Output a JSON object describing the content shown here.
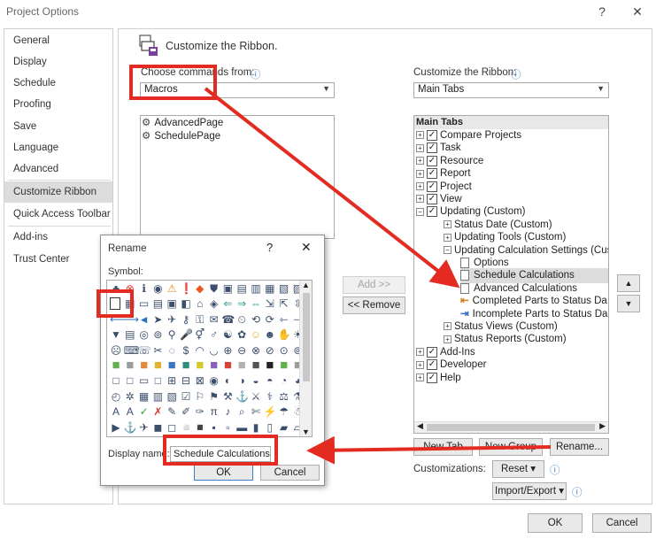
{
  "window": {
    "title": "Project Options",
    "help_btn": "?",
    "close_btn": "✕"
  },
  "nav": {
    "items": [
      {
        "label": "General"
      },
      {
        "label": "Display"
      },
      {
        "label": "Schedule"
      },
      {
        "label": "Proofing"
      },
      {
        "label": "Save"
      },
      {
        "label": "Language"
      },
      {
        "label": "Advanced"
      },
      {
        "label": "Customize Ribbon",
        "active": true
      },
      {
        "label": "Quick Access Toolbar"
      },
      {
        "label": "Add-ins"
      },
      {
        "label": "Trust Center"
      }
    ]
  },
  "main": {
    "heading": "Customize the Ribbon.",
    "choose_label": "Choose commands from:",
    "choose_value": "Macros",
    "ribbon_label": "Customize the Ribbon:",
    "ribbon_value": "Main Tabs",
    "info_icon": "ⓘ",
    "commands": [
      {
        "label": "AdvancedPage"
      },
      {
        "label": "SchedulePage"
      }
    ],
    "add_btn": "Add >>",
    "remove_btn": "<< Remove",
    "tree_header": "Main Tabs",
    "tree": [
      {
        "label": "Compare Projects",
        "level": 0,
        "exp": "+",
        "chk": true
      },
      {
        "label": "Task",
        "level": 0,
        "exp": "+",
        "chk": true
      },
      {
        "label": "Resource",
        "level": 0,
        "exp": "+",
        "chk": true
      },
      {
        "label": "Report",
        "level": 0,
        "exp": "+",
        "chk": true
      },
      {
        "label": "Project",
        "level": 0,
        "exp": "+",
        "chk": true
      },
      {
        "label": "View",
        "level": 0,
        "exp": "+",
        "chk": true
      },
      {
        "label": "Updating (Custom)",
        "level": 0,
        "exp": "−",
        "chk": true
      },
      {
        "label": "Status Date (Custom)",
        "level": 1,
        "exp": "+"
      },
      {
        "label": "Updating Tools (Custom)",
        "level": 1,
        "exp": "+"
      },
      {
        "label": "Updating Calculation Settings (Custo",
        "level": 1,
        "exp": "−"
      },
      {
        "label": "Options",
        "level": 2,
        "icon": "page"
      },
      {
        "label": "Schedule Calculations",
        "level": 2,
        "icon": "page",
        "selected": true
      },
      {
        "label": "Advanced Calculations",
        "level": 2,
        "icon": "page"
      },
      {
        "label": "Completed Parts to Status Da",
        "level": 2,
        "icon": "arrow-left"
      },
      {
        "label": "Incomplete Parts to Status Da",
        "level": 2,
        "icon": "arrow-right"
      },
      {
        "label": "Status Views (Custom)",
        "level": 1,
        "exp": "+"
      },
      {
        "label": "Status Reports (Custom)",
        "level": 1,
        "exp": "+"
      },
      {
        "label": "Add-Ins",
        "level": 0,
        "exp": "+",
        "chk": true
      },
      {
        "label": "Developer",
        "level": 0,
        "exp": "+",
        "chk": true
      },
      {
        "label": "Help",
        "level": 0,
        "exp": "+",
        "chk": true
      }
    ],
    "new_tab_btn": "New Tab",
    "new_group_btn": "New Group",
    "rename_btn": "Rename...",
    "customizations_label": "Customizations:",
    "reset_btn": "Reset ▾",
    "import_export_btn": "Import/Export ▾",
    "up_arrow": "▲",
    "down_arrow": "▼"
  },
  "footer": {
    "ok_btn": "OK",
    "cancel_btn": "Cancel"
  },
  "rename_dialog": {
    "title": "Rename",
    "help_btn": "?",
    "close_btn": "✕",
    "symbol_label": "Symbol:",
    "display_name_label": "Display name:",
    "display_name_value": "Schedule Calculations",
    "ok_btn": "OK",
    "cancel_btn": "Cancel"
  },
  "colors": {
    "annotation_red": "#e32b21",
    "selection": "#dcdcdc"
  }
}
